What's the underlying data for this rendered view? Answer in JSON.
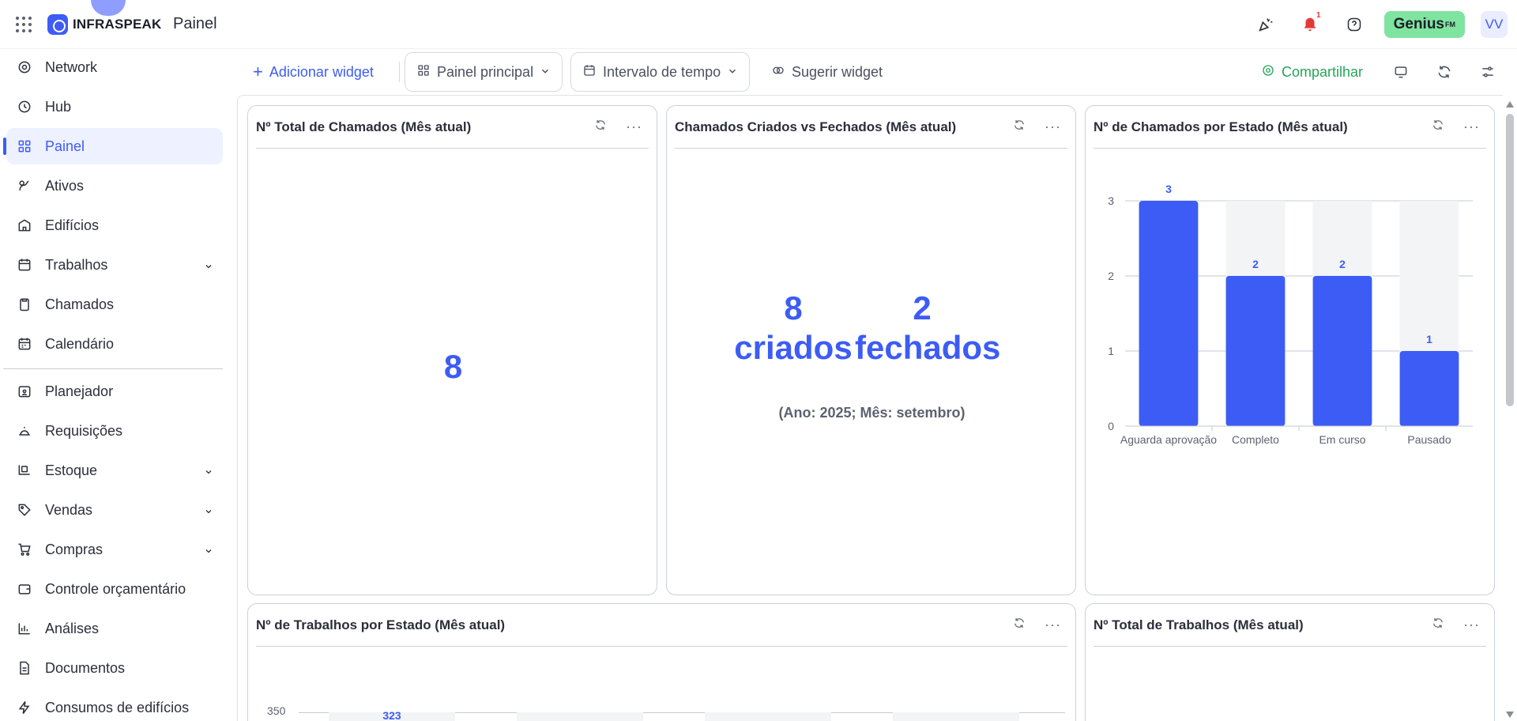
{
  "app": {
    "logo_text": "INFRASPEAK",
    "title": "Painel"
  },
  "topbar": {
    "notif_count": "1",
    "genius_label": "Genius",
    "genius_sup": "FM",
    "avatar_initials": "VV"
  },
  "sidebar": {
    "items": [
      {
        "label": "Network",
        "icon": "network-icon"
      },
      {
        "label": "Hub",
        "icon": "hub-icon"
      },
      {
        "label": "Painel",
        "icon": "dashboard-icon",
        "active": true
      },
      {
        "label": "Ativos",
        "icon": "assets-icon"
      },
      {
        "label": "Edifícios",
        "icon": "building-icon"
      },
      {
        "label": "Trabalhos",
        "icon": "calendar-grid-icon",
        "expandable": true
      },
      {
        "label": "Chamados",
        "icon": "clipboard-icon"
      },
      {
        "label": "Calendário",
        "icon": "calendar-icon"
      },
      {
        "label": "Planejador",
        "icon": "planner-icon"
      },
      {
        "label": "Requisições",
        "icon": "bell-service-icon"
      },
      {
        "label": "Estoque",
        "icon": "stock-icon",
        "expandable": true
      },
      {
        "label": "Vendas",
        "icon": "tag-icon",
        "expandable": true
      },
      {
        "label": "Compras",
        "icon": "cart-icon",
        "expandable": true
      },
      {
        "label": "Controle orçamentário",
        "icon": "wallet-icon"
      },
      {
        "label": "Análises",
        "icon": "bar-chart-icon"
      },
      {
        "label": "Documentos",
        "icon": "document-icon"
      },
      {
        "label": "Consumos de edifícios",
        "icon": "lightning-icon"
      }
    ]
  },
  "toolbar": {
    "add_widget": "Adicionar widget",
    "dashboard_select": "Painel principal",
    "time_range": "Intervalo de tempo",
    "suggest_widget": "Sugerir widget",
    "share": "Compartilhar"
  },
  "widgets": {
    "total_tickets": {
      "title": "Nº Total de Chamados (Mês atual)",
      "value": "8"
    },
    "created_vs_closed": {
      "title": "Chamados Criados vs Fechados (Mês atual)",
      "created_value": "8",
      "created_label": "criados",
      "closed_value": "2",
      "closed_label": "fechados",
      "period": "(Ano: 2025; Mês: setembro)"
    },
    "tickets_by_state": {
      "title": "Nº de Chamados por Estado (Mês atual)"
    },
    "jobs_by_state": {
      "title": "Nº de Trabalhos por Estado (Mês atual)",
      "axis_top": "350",
      "first_value": "323"
    },
    "total_jobs": {
      "title": "Nº Total de Trabalhos (Mês atual)"
    }
  },
  "chart_data": {
    "type": "bar",
    "title": "Nº de Chamados por Estado (Mês atual)",
    "categories": [
      "Aguarda aprovação",
      "Completo",
      "Em curso",
      "Pausado"
    ],
    "values": [
      3,
      2,
      2,
      1
    ],
    "ylim": [
      0,
      3
    ],
    "yticks": [
      "0",
      "1",
      "2",
      "3"
    ],
    "grid": true,
    "bar_color": "#3d5cf5",
    "track_color": "#f3f4f6"
  }
}
